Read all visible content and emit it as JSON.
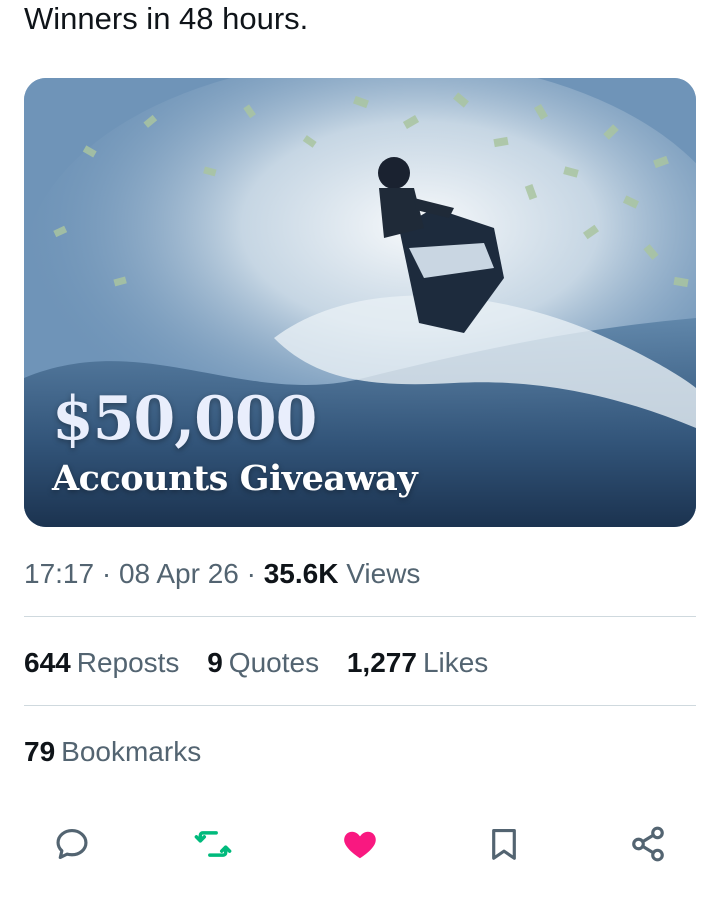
{
  "tweet": {
    "text": "Winners in 48 hours."
  },
  "media": {
    "headline": "$50,000",
    "subheadline": "Accounts Giveaway"
  },
  "meta": {
    "time": "17:17",
    "date": "08 Apr 26",
    "views_count": "35.6K",
    "views_label": "Views",
    "separator": "·"
  },
  "stats": {
    "reposts": {
      "count": "644",
      "label": "Reposts"
    },
    "quotes": {
      "count": "9",
      "label": "Quotes"
    },
    "likes": {
      "count": "1,277",
      "label": "Likes"
    },
    "bookmarks": {
      "count": "79",
      "label": "Bookmarks"
    }
  },
  "actions": {
    "icons": [
      "reply-icon",
      "repost-icon",
      "like-icon",
      "bookmark-icon",
      "share-icon"
    ],
    "colors": {
      "default": "#536471",
      "repost_active": "#00ba7c",
      "like_active": "#f91880"
    }
  }
}
